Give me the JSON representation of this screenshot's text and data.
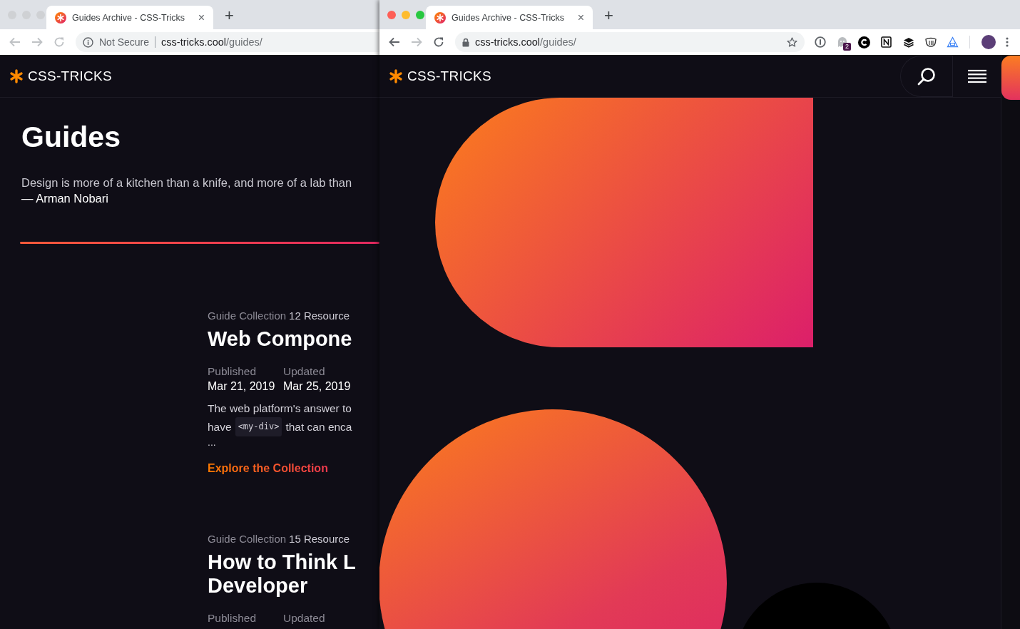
{
  "windows": [
    {
      "active": false,
      "tab": {
        "title": "Guides Archive - CSS-Tricks",
        "close": "×"
      },
      "new_tab": "+",
      "address": {
        "secure": false,
        "security_label": "Not Secure",
        "host": "css-tricks.cool",
        "path": "/guides/"
      },
      "page": {
        "kind": "archive",
        "logo": "CSS-TRICKS",
        "heading": "Guides",
        "quote": "Design is more of a kitchen than a knife, and more of a lab than",
        "author": "— Arman Nobari",
        "guides": [
          {
            "meta": "Guide Collection",
            "count": "12 Resource",
            "title_lines": [
              "Web Compone"
            ],
            "published_label": "Published",
            "published": "Mar 21, 2019",
            "updated_label": "Updated",
            "updated": "Mar 25, 2019",
            "excerpt_lines": [
              [
                {
                  "kind": "text",
                  "text": "The web platform's answer to"
                }
              ],
              [
                {
                  "kind": "text",
                  "text": "have"
                },
                {
                  "kind": "code",
                  "text": "<my-div>"
                },
                {
                  "kind": "text",
                  "text": "that can enca"
                }
              ]
            ],
            "ellipsis": "...",
            "link": "Explore the Collection"
          },
          {
            "meta": "Guide Collection",
            "count": "15 Resource",
            "title_lines": [
              "How to Think L",
              "Developer"
            ],
            "published_label": "Published",
            "updated_label": "Updated"
          }
        ]
      }
    },
    {
      "active": true,
      "tab": {
        "title": "Guides Archive - CSS-Tricks",
        "close": "×"
      },
      "new_tab": "+",
      "address": {
        "secure": true,
        "host": "css-tricks.cool",
        "path": "/guides/"
      },
      "extensions": [
        {
          "kind": "info"
        },
        {
          "kind": "ghost",
          "badge": "2"
        },
        {
          "kind": "arc"
        },
        {
          "kind": "square"
        },
        {
          "kind": "layers"
        },
        {
          "kind": "hand"
        },
        {
          "kind": "triangle"
        }
      ],
      "page": {
        "kind": "art",
        "logo": "CSS-TRICKS"
      }
    }
  ]
}
